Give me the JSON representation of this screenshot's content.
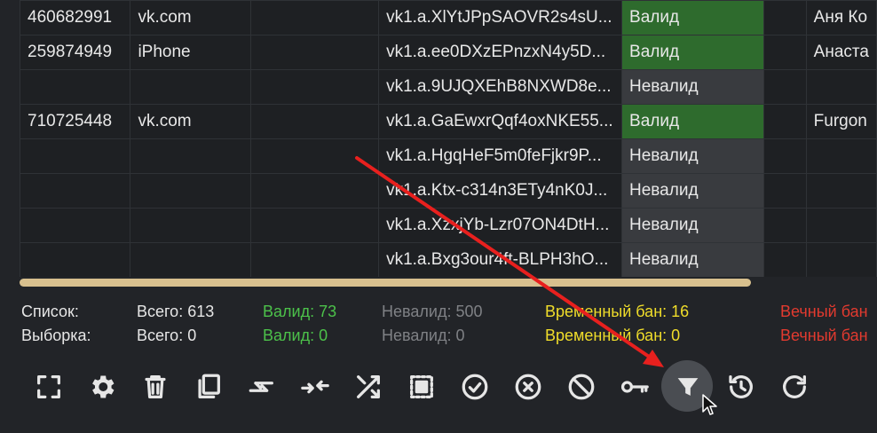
{
  "table": {
    "rows": [
      {
        "id": "460682991",
        "device": "vk.com",
        "blank": "",
        "token": "vk1.a.XlYtJPpSAOVR2s4sU...",
        "status": "Валид",
        "status_type": "valid",
        "name": "Аня Ко"
      },
      {
        "id": "259874949",
        "device": "iPhone",
        "blank": "",
        "token": "vk1.a.ee0DXzEPnzxN4y5D...",
        "status": "Валид",
        "status_type": "valid",
        "name": "Анаста"
      },
      {
        "id": "",
        "device": "",
        "blank": "",
        "token": "vk1.a.9UJQXEhB8NXWD8e...",
        "status": "Невалид",
        "status_type": "invalid",
        "name": ""
      },
      {
        "id": "710725448",
        "device": "vk.com",
        "blank": "",
        "token": "vk1.a.GaEwxrQqf4oxNKE55...",
        "status": "Валид",
        "status_type": "valid",
        "name": "Furgon"
      },
      {
        "id": "",
        "device": "",
        "blank": "",
        "token": "vk1.a.HgqHeF5m0feFjkr9P...",
        "status": "Невалид",
        "status_type": "invalid",
        "name": ""
      },
      {
        "id": "",
        "device": "",
        "blank": "",
        "token": "vk1.a.Ktx-c314n3ETy4nK0J...",
        "status": "Невалид",
        "status_type": "invalid",
        "name": ""
      },
      {
        "id": "",
        "device": "",
        "blank": "",
        "token": "vk1.a.XzxjYb-Lzr07ON4DtH...",
        "status": "Невалид",
        "status_type": "invalid",
        "name": ""
      },
      {
        "id": "",
        "device": "",
        "blank": "",
        "token": "vk1.a.Bxg3our4ft-BLPH3hO...",
        "status": "Невалид",
        "status_type": "invalid",
        "name": ""
      }
    ]
  },
  "stats": {
    "list": {
      "label": "Список:",
      "total": "Всего: 613",
      "valid": "Валид: 73",
      "invalid": "Невалид: 500",
      "temp_ban": "Временный бан: 16",
      "perm_ban": "Вечный бан"
    },
    "selection": {
      "label": "Выборка:",
      "total": "Всего: 0",
      "valid": "Валид: 0",
      "invalid": "Невалид: 0",
      "temp_ban": "Временный бан: 0",
      "perm_ban": "Вечный бан"
    }
  },
  "toolbar": {
    "buttons": [
      "fullscreen-icon",
      "settings-icon",
      "delete-icon",
      "copy-icon",
      "swap-icon",
      "merge-icon",
      "shuffle-icon",
      "select-all-icon",
      "check-circle-icon",
      "x-circle-icon",
      "block-icon",
      "key-icon",
      "filter-icon",
      "history-icon",
      "refresh-icon"
    ],
    "active": "filter-icon"
  },
  "colors": {
    "valid_bg": "#2e6b2d",
    "invalid_bg": "#393b3f",
    "valid_text": "#4cc14a",
    "invalid_text": "#7f8185",
    "temp_text": "#f0dd2a",
    "perm_text": "#e23a2f",
    "arrow": "#e8201e",
    "scrollbar": "#d8c08e"
  }
}
